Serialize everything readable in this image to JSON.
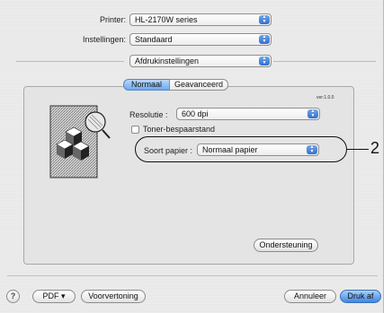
{
  "printer": {
    "label": "Printer:",
    "value": "HL-2170W series"
  },
  "settings": {
    "label": "Instellingen:",
    "value": "Standaard"
  },
  "panel_selector": {
    "value": "Afdrukinstellingen"
  },
  "tabs": [
    {
      "label": "Normaal"
    },
    {
      "label": "Geavanceerd"
    }
  ],
  "version": "ver:1.0.0",
  "resolution": {
    "label": "Resolutie :",
    "value": "600 dpi"
  },
  "toner_save": {
    "label": "Toner-bespaarstand",
    "checked": false
  },
  "paper_type": {
    "label": "Soort papier :",
    "value": "Normaal papier"
  },
  "callout": "2",
  "support_button": "Ondersteuning",
  "footer": {
    "help": "?",
    "pdf": "PDF ▾",
    "preview": "Voorvertoning",
    "cancel": "Annuleer",
    "print": "Druk af"
  }
}
